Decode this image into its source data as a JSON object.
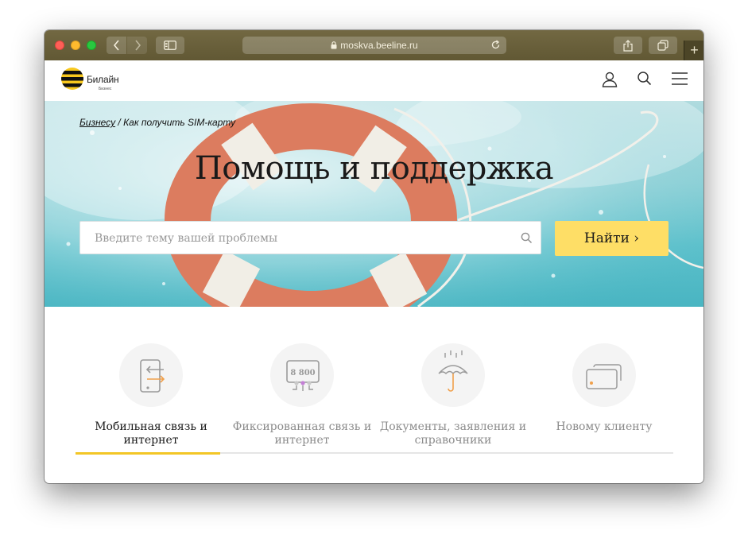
{
  "browser": {
    "url": "moskva.beeline.ru",
    "new_tab": "+"
  },
  "site": {
    "logo_text": "Билайн",
    "logo_sub": "Бизнес"
  },
  "hero": {
    "breadcrumb_root": "Бизнесу",
    "breadcrumb_sep": "/",
    "breadcrumb_current": "Как получить SIM-карту",
    "title": "Помощь и поддержка",
    "search_placeholder": "Введите тему вашей проблемы",
    "find_button": "Найти ›"
  },
  "categories": [
    {
      "label": "Мобильная связь и интернет",
      "icon": "mobile-transfer-icon",
      "active": true
    },
    {
      "label": "Фиксированная связь и интернет",
      "icon": "router-8800-icon",
      "active": false
    },
    {
      "label": "Документы, заявления и справочники",
      "icon": "umbrella-icon",
      "active": false
    },
    {
      "label": "Новому клиенту",
      "icon": "sim-cards-icon",
      "active": false
    }
  ],
  "router_icon_text": "8 800",
  "colors": {
    "titlebar": "#6b6240",
    "brand_yellow": "#fede66",
    "active_underline": "#f3c626",
    "accent_orange": "#f0a04b",
    "accent_purple": "#c47fd6"
  }
}
